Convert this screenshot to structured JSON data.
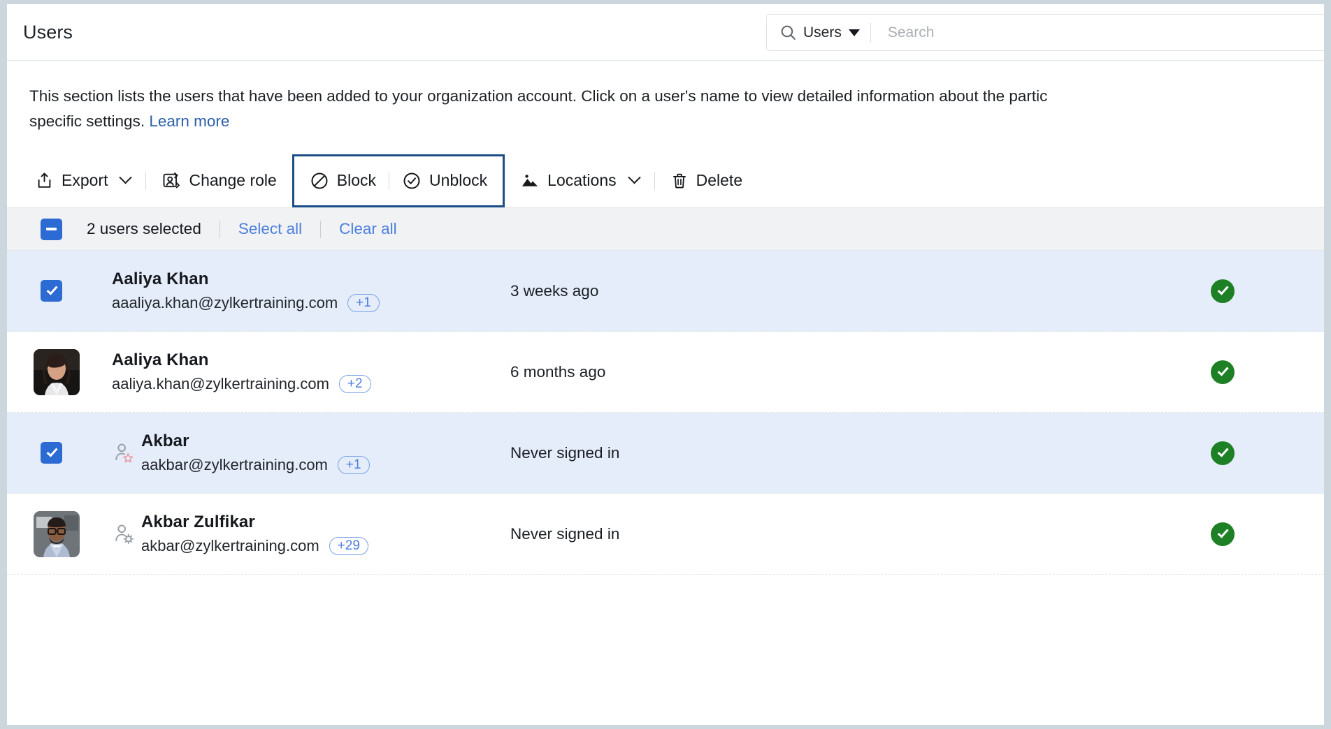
{
  "header": {
    "title": "Users",
    "search": {
      "scope_label": "Users",
      "placeholder": "Search",
      "value": "",
      "search_icon": "search-icon",
      "caret_icon": "chevron-down-icon"
    }
  },
  "description": {
    "line1": "This section lists the users that have been added to your organization account. Click on a user's name to view detailed information about the partic",
    "line2_prefix": "specific settings. ",
    "learn_more": "Learn more"
  },
  "toolbar": {
    "export": {
      "label": "Export",
      "icon": "export-icon",
      "caret": "chevron-down-icon"
    },
    "change_role": {
      "label": "Change role",
      "icon": "user-swap-icon"
    },
    "block": {
      "label": "Block",
      "icon": "circle-slash-icon"
    },
    "unblock": {
      "label": "Unblock",
      "icon": "circle-check-icon"
    },
    "locations": {
      "label": "Locations",
      "icon": "landscape-icon",
      "caret": "chevron-down-icon"
    },
    "delete": {
      "label": "Delete",
      "icon": "trash-icon"
    },
    "highlighted_group": [
      "Block",
      "Unblock"
    ]
  },
  "selection_bar": {
    "checkbox_state": "indeterminate",
    "count_label": "2 users selected",
    "select_all": "Select all",
    "clear_all": "Clear all"
  },
  "users": [
    {
      "name": "Aaliya Khan",
      "email": "aaaliya.khan@zylkertraining.com",
      "badge": "+1",
      "last_signin": "3 weeks ago",
      "selected": true,
      "has_avatar": false,
      "role_icon": "",
      "status": "active"
    },
    {
      "name": "Aaliya Khan",
      "email": "aaliya.khan@zylkertraining.com",
      "badge": "+2",
      "last_signin": "6 months ago",
      "selected": false,
      "has_avatar": true,
      "avatar_type": "woman-portrait",
      "role_icon": "",
      "status": "active"
    },
    {
      "name": "Akbar",
      "email": "aakbar@zylkertraining.com",
      "badge": "+1",
      "last_signin": "Never signed in",
      "selected": true,
      "has_avatar": false,
      "role_icon": "user-star-icon",
      "status": "active"
    },
    {
      "name": "Akbar Zulfikar",
      "email": "akbar@zylkertraining.com",
      "badge": "+29",
      "last_signin": "Never signed in",
      "selected": false,
      "has_avatar": true,
      "avatar_type": "man-glasses-portrait",
      "role_icon": "user-gear-icon",
      "status": "active"
    }
  ],
  "colors": {
    "accent_blue": "#2c6ad4",
    "link_blue": "#4c7fdd",
    "highlight_border": "#1b4e87",
    "row_selected_bg": "#e5edfb",
    "status_green": "#1e8024",
    "page_bg": "#ccd6dd"
  }
}
